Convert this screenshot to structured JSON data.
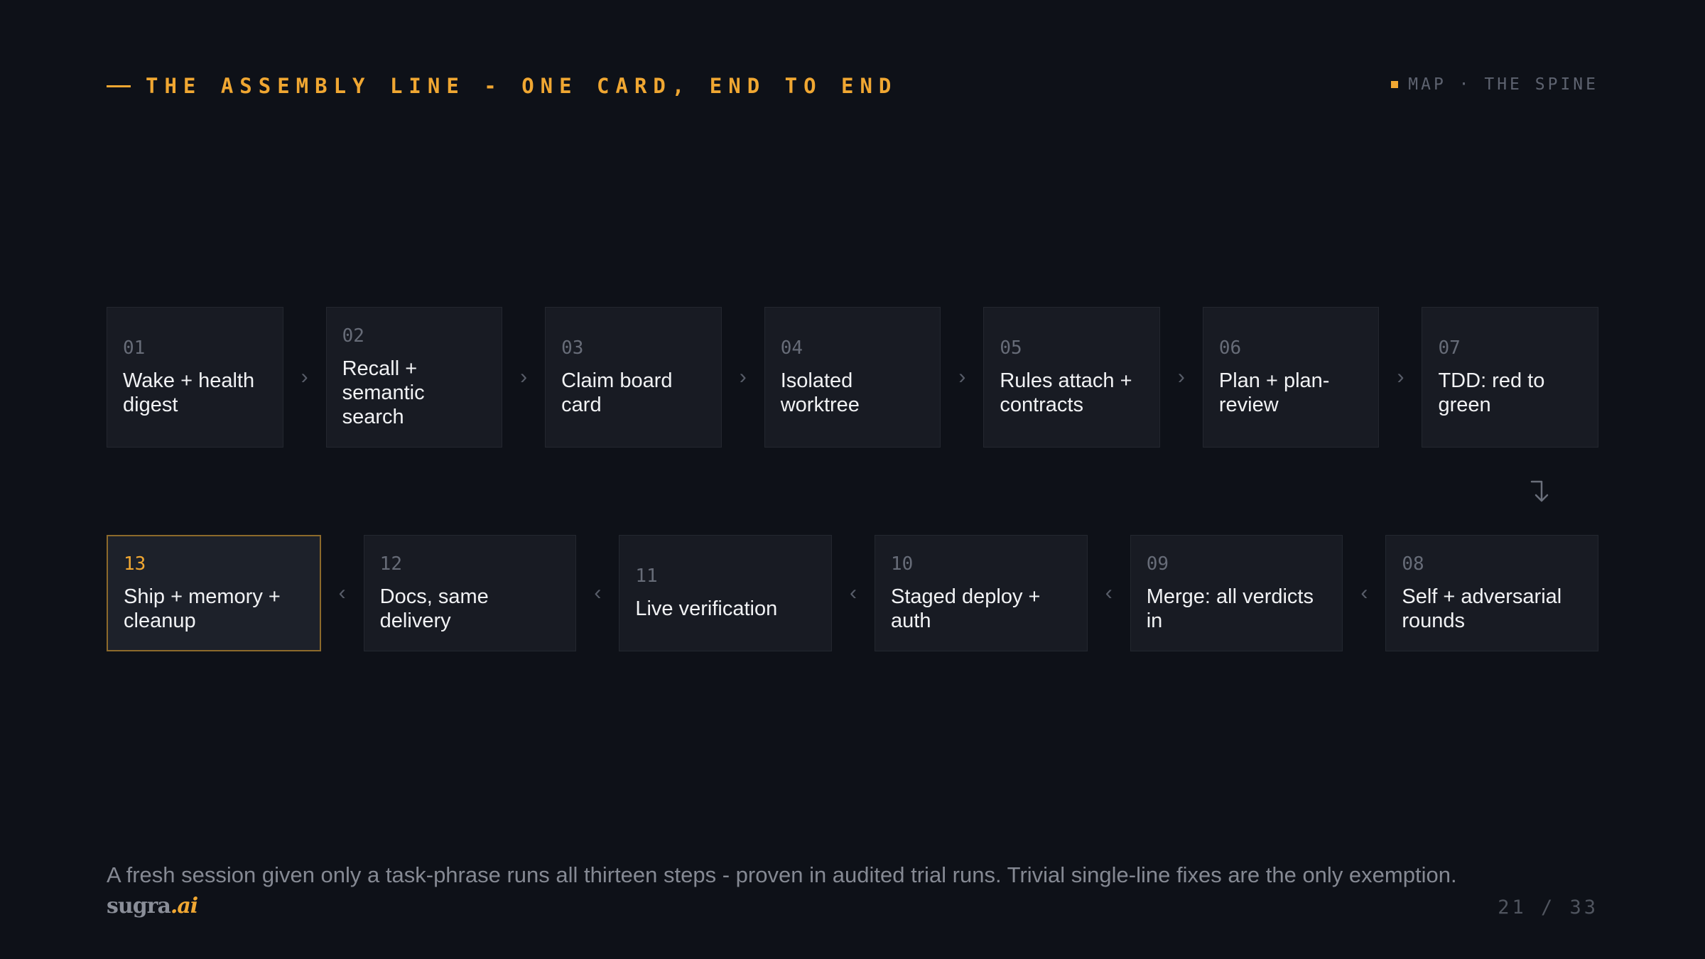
{
  "header": {
    "eyebrow": "THE ASSEMBLY LINE - ONE CARD, END TO END",
    "tag": "MAP · THE SPINE"
  },
  "colors": {
    "background": "#0e1118",
    "accent": "#f0a732",
    "card": "#181b23",
    "card_active_border": "#8c6a2b"
  },
  "steps_row1": [
    {
      "num": "01",
      "label": "Wake + health digest"
    },
    {
      "num": "02",
      "label": "Recall + semantic search"
    },
    {
      "num": "03",
      "label": "Claim board card"
    },
    {
      "num": "04",
      "label": "Isolated worktree"
    },
    {
      "num": "05",
      "label": "Rules attach + contracts"
    },
    {
      "num": "06",
      "label": "Plan + plan-review"
    },
    {
      "num": "07",
      "label": "TDD: red to green"
    }
  ],
  "steps_row2": [
    {
      "num": "13",
      "label": "Ship + memory + cleanup",
      "active": true
    },
    {
      "num": "12",
      "label": "Docs, same delivery"
    },
    {
      "num": "11",
      "label": "Live verification"
    },
    {
      "num": "10",
      "label": "Staged deploy + auth"
    },
    {
      "num": "09",
      "label": "Merge: all verdicts in"
    },
    {
      "num": "08",
      "label": "Self + adversarial rounds"
    }
  ],
  "icons": {
    "forward": "chevron-right-icon",
    "back": "chevron-left-icon",
    "turn": "turn-down-arrow-icon"
  },
  "footer": {
    "text": "A fresh session given only a task-phrase runs all thirteen steps - proven in audited trial runs. Trivial single-line fixes are the only exemption.",
    "brand_main": "sugra",
    "brand_accent": ".ai",
    "page": "21 / 33"
  }
}
